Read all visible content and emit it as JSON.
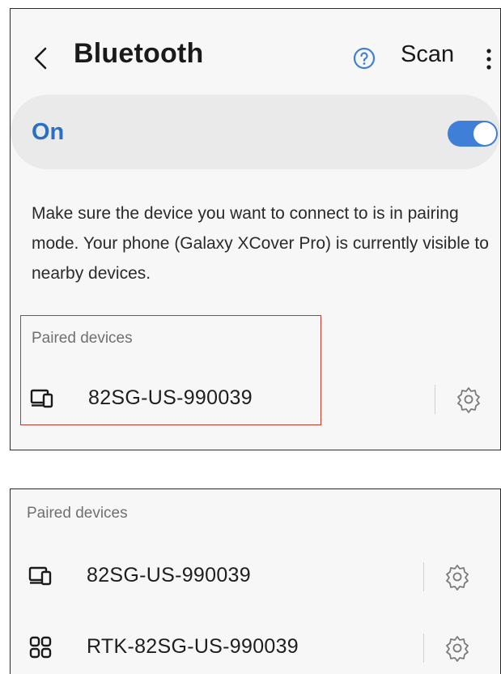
{
  "header": {
    "back_icon": "chevron-left-icon",
    "title": "Bluetooth",
    "help_icon": "help-circle-icon",
    "scan_label": "Scan",
    "more_icon": "more-vertical-icon"
  },
  "bluetooth_toggle": {
    "label": "On",
    "state": true,
    "accent_color": "#3f7fd8"
  },
  "description": "Make sure the device you want to connect to is in pairing mode. Your phone (Galaxy XCover Pro) is currently visible to nearby devices.",
  "top_panel": {
    "section_title": "Paired devices",
    "devices": [
      {
        "name": "82SG-US-990039",
        "icon": "computer-device-icon"
      }
    ],
    "highlight_color": "#c0392b"
  },
  "bottom_panel": {
    "section_title": "Paired devices",
    "devices": [
      {
        "name": "82SG-US-990039",
        "icon": "computer-device-icon"
      },
      {
        "name": "RTK-82SG-US-990039",
        "icon": "grid-device-icon"
      }
    ]
  }
}
